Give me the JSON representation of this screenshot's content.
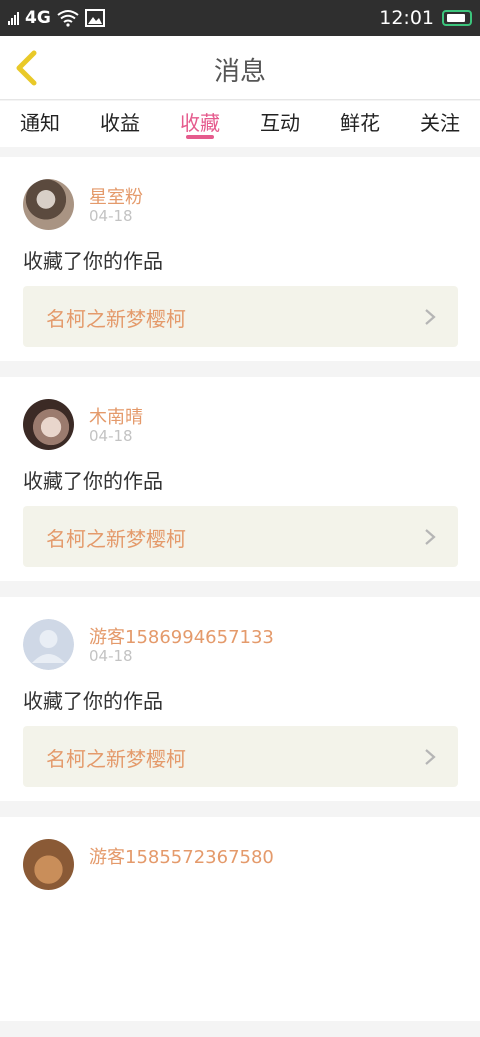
{
  "status": {
    "network": "4G",
    "time": "12:01"
  },
  "header": {
    "title": "消息"
  },
  "tabs": [
    {
      "label": "通知",
      "active": false
    },
    {
      "label": "收益",
      "active": false
    },
    {
      "label": "收藏",
      "active": true
    },
    {
      "label": "互动",
      "active": false
    },
    {
      "label": "鲜花",
      "active": false
    },
    {
      "label": "关注",
      "active": false
    }
  ],
  "items": [
    {
      "user": "星室粉",
      "date": "04-18",
      "action": "收藏了你的作品",
      "work": "名柯之新梦樱柯",
      "avatar": "photo-dark"
    },
    {
      "user": "木南晴",
      "date": "04-18",
      "action": "收藏了你的作品",
      "work": "名柯之新梦樱柯",
      "avatar": "photo-portrait"
    },
    {
      "user": "游客1586994657133",
      "date": "04-18",
      "action": "收藏了你的作品",
      "work": "名柯之新梦樱柯",
      "avatar": "default-user"
    },
    {
      "user": "游客1585572367580",
      "date": "",
      "action": "",
      "work": "",
      "avatar": "photo-brown"
    }
  ],
  "colors": {
    "accent": "#e55b8d",
    "name": "#e49a6b",
    "back_arrow": "#e9c928"
  }
}
